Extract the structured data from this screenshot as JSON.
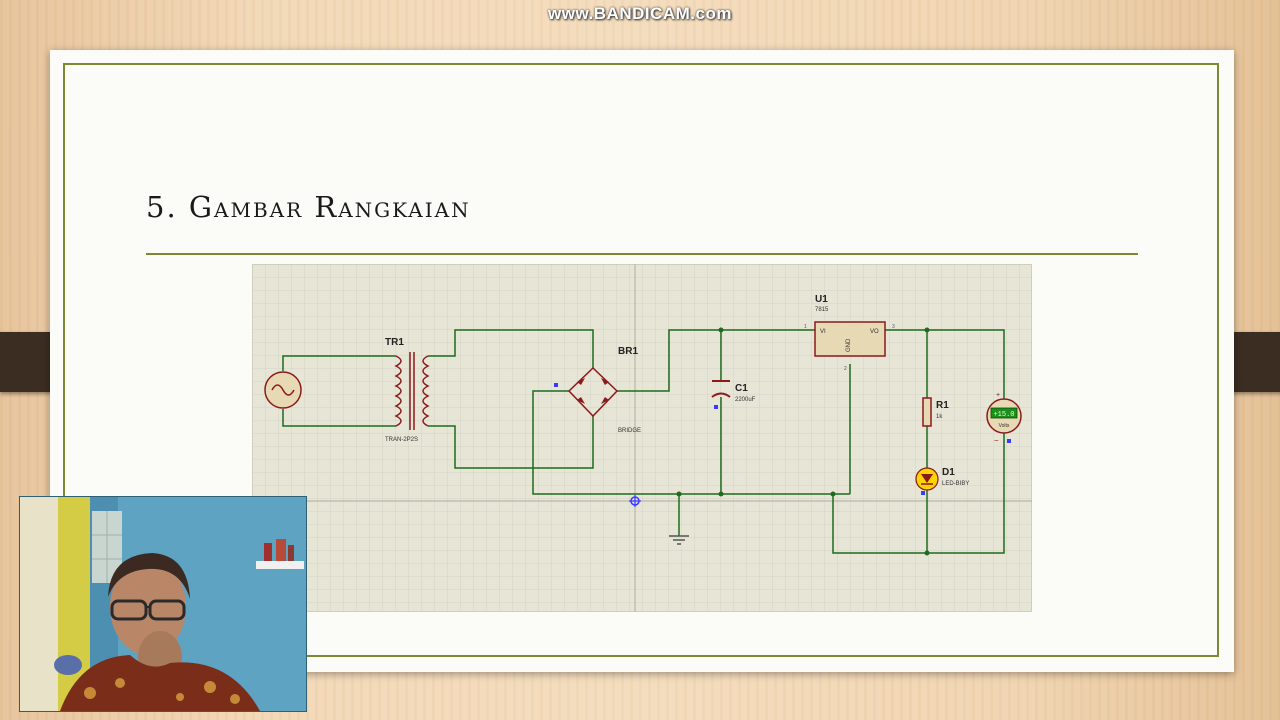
{
  "watermark": "www.BANDICAM.com",
  "slide": {
    "title": "5. Gambar Rangkaian"
  },
  "schematic": {
    "components": {
      "transformer": {
        "ref": "TR1",
        "value": "TRAN-2P2S"
      },
      "bridge": {
        "ref": "BR1",
        "value": "BRIDGE"
      },
      "capacitor": {
        "ref": "C1",
        "value": "2200uF"
      },
      "regulator": {
        "ref": "U1",
        "value": "7815",
        "pin_vi": "VI",
        "pin_vo": "VO",
        "pin_gnd": "GND",
        "pin1": "1",
        "pin2": "2",
        "pin3": "3"
      },
      "resistor": {
        "ref": "R1",
        "value": "1k"
      },
      "led": {
        "ref": "D1",
        "value": "LED-BIBY"
      },
      "voltmeter": {
        "reading": "+15.0",
        "unit": "Volts",
        "plus": "+",
        "minus": "−"
      }
    }
  },
  "colors": {
    "wire": "#1f6b1f",
    "component": "#8b1a1a",
    "component_fill": "#e8d9b5",
    "grid_minor": "#cfcdbf",
    "grid_major": "#b9b7a8",
    "led": "#ffd400",
    "accent": "#7a8a34"
  },
  "icons": {
    "ac_source": "ac-source-icon",
    "ground": "ground-icon",
    "origin_marker": "origin-crosshair-icon"
  }
}
